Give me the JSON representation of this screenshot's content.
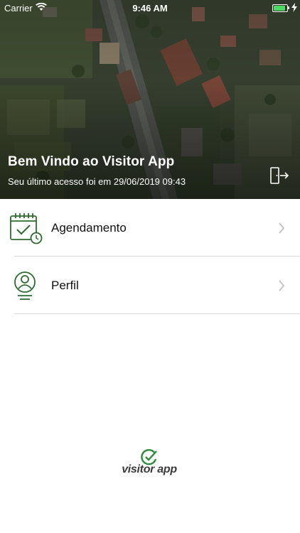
{
  "status_bar": {
    "carrier": "Carrier",
    "time": "9:46 AM",
    "battery_color": "#4cd964"
  },
  "header": {
    "title": "Bem Vindo ao Visitor App",
    "last_access": "Seu último acesso foi em 29/06/2019 09:43",
    "logout_icon": "logout-icon"
  },
  "menu": {
    "items": [
      {
        "label": "Agendamento",
        "icon": "calendar-check-icon"
      },
      {
        "label": "Perfil",
        "icon": "user-profile-icon"
      }
    ],
    "accent_color": "#2e7d32"
  },
  "footer": {
    "brand_name": "visitor app",
    "brand_color": "#2e8b3a"
  }
}
